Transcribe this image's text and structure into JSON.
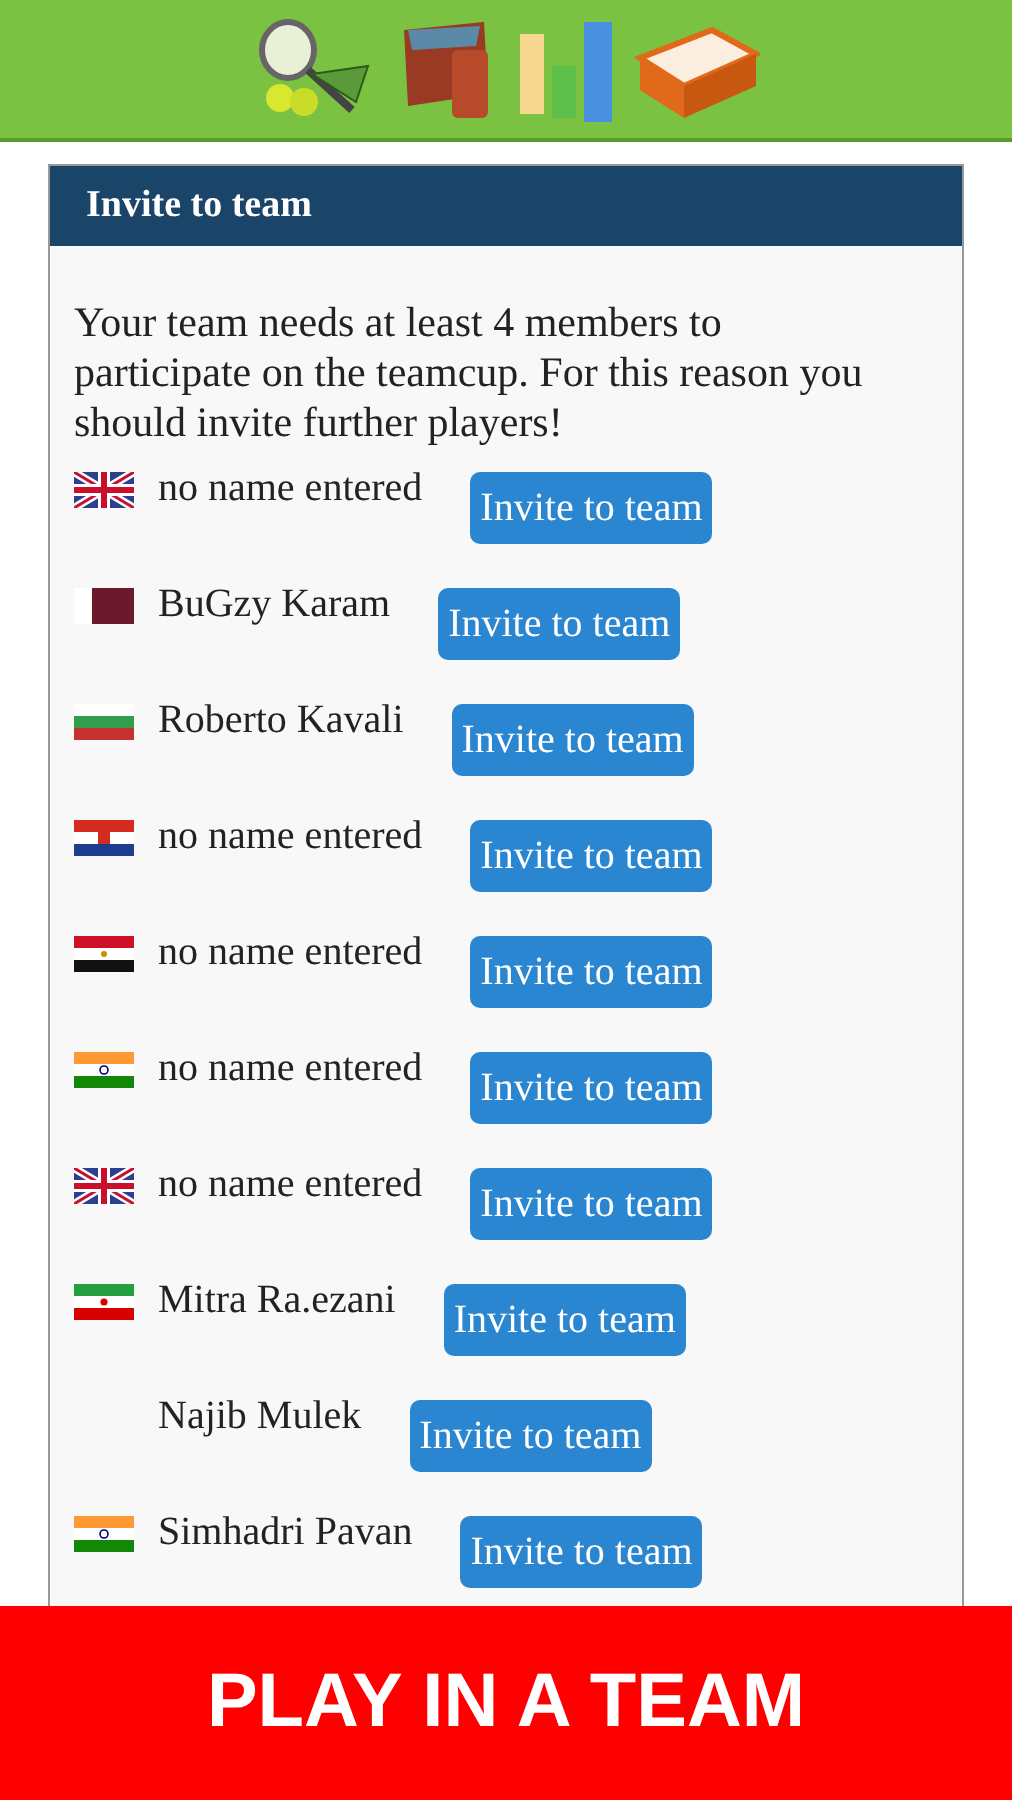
{
  "toolbar": {
    "icons": [
      {
        "kind": "tennis"
      },
      {
        "kind": "wallet"
      },
      {
        "kind": "chart"
      },
      {
        "kind": "tray"
      }
    ]
  },
  "panel": {
    "title": "Invite to team",
    "intro": "Your team needs at least 4 members to participate on the teamcup. For this reason you should invite further players!",
    "players": [
      {
        "kind": "uk",
        "name": "no name entered",
        "action": "Invite to team"
      },
      {
        "kind": "qatar",
        "name": "BuGzy Karam",
        "action": "Invite to team"
      },
      {
        "kind": "bulgaria",
        "name": "Roberto Kavali",
        "action": "Invite to team"
      },
      {
        "kind": "croatia",
        "name": "no name entered",
        "action": "Invite to team"
      },
      {
        "kind": "egypt",
        "name": "no name entered",
        "action": "Invite to team"
      },
      {
        "kind": "india",
        "name": "no name entered",
        "action": "Invite to team"
      },
      {
        "kind": "uk",
        "name": "no name entered",
        "action": "Invite to team"
      },
      {
        "kind": "iran",
        "name": "Mitra Ra.ezani",
        "action": "Invite to team"
      },
      {
        "kind": "none",
        "name": "Najib Mulek",
        "action": "Invite to team"
      },
      {
        "kind": "india",
        "name": "Simhadri Pavan",
        "action": "Invite to team"
      }
    ]
  },
  "banner": {
    "text": "PLAY IN A TEAM"
  }
}
